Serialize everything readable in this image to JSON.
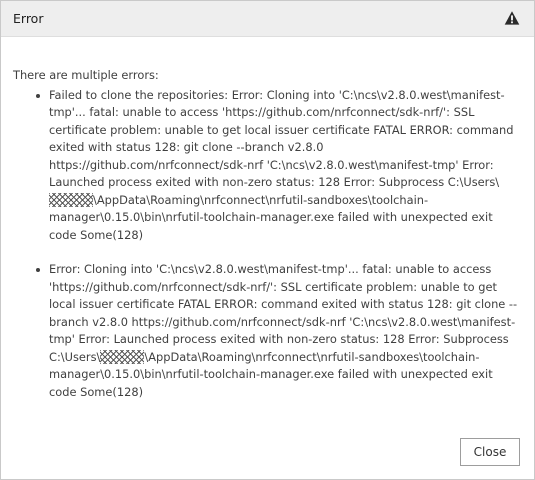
{
  "dialog": {
    "title": "Error",
    "title_icon": "warning-triangle-icon",
    "intro": "There are multiple errors:",
    "errors": [
      {
        "before_redaction": "Failed to clone the repositories: Error: Cloning into 'C:\\ncs\\v2.8.0.west\\manifest-tmp'... fatal: unable to access 'https://github.com/nrfconnect/sdk-nrf/': SSL certificate problem: unable to get local issuer certificate FATAL ERROR: command exited with status 128: git clone --branch v2.8.0 https://github.com/nrfconnect/sdk-nrf 'C:\\ncs\\v2.8.0.west\\manifest-tmp' Error: Launched process exited with non-zero status: 128 Error: Subprocess C:\\Users\\",
        "after_redaction": "\\AppData\\Roaming\\nrfconnect\\nrfutil-sandboxes\\toolchain-manager\\0.15.0\\bin\\nrfutil-toolchain-manager.exe failed with unexpected exit code Some(128)"
      },
      {
        "before_redaction": "Error: Cloning into 'C:\\ncs\\v2.8.0.west\\manifest-tmp'... fatal: unable to access 'https://github.com/nrfconnect/sdk-nrf/': SSL certificate problem: unable to get local issuer certificate FATAL ERROR: command exited with status 128: git clone --branch v2.8.0 https://github.com/nrfconnect/sdk-nrf 'C:\\ncs\\v2.8.0.west\\manifest-tmp' Error: Launched process exited with non-zero status: 128 Error: Subprocess C:\\Users\\",
        "after_redaction": "\\AppData\\Roaming\\nrfconnect\\nrfutil-sandboxes\\toolchain-manager\\0.15.0\\bin\\nrfutil-toolchain-manager.exe failed with unexpected exit code Some(128)"
      }
    ],
    "close_label": "Close"
  },
  "colors": {
    "titlebar_bg": "#eeeeee",
    "text": "#404040",
    "border": "#c9c9c9"
  }
}
